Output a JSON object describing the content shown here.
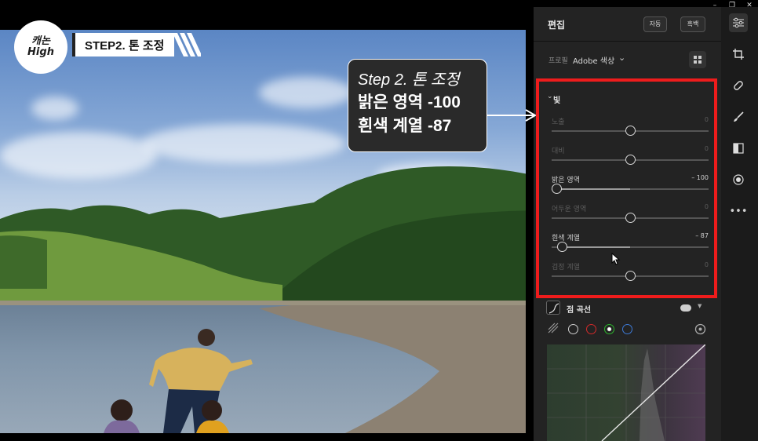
{
  "window": {
    "minimize": "–",
    "restore": "❐",
    "close": "✕"
  },
  "overlay": {
    "logo_line1": "캐논",
    "logo_line2": "High",
    "step_banner": "STEP2. 톤 조정",
    "callout_line1": "Step 2. 톤 조정",
    "callout_line2": "밝은 영역 -100",
    "callout_line3": "흰색 계열 -87"
  },
  "panel": {
    "title": "편집",
    "auto_button": "자동",
    "bw_button": "흑백",
    "profile_label": "프로필",
    "profile_value": "Adobe 색상",
    "light_section": {
      "title": "빛",
      "sliders": [
        {
          "label": "노출",
          "value": "0",
          "level": 0.5,
          "active": false
        },
        {
          "label": "대비",
          "value": "0",
          "level": 0.5,
          "active": false
        },
        {
          "label": "밝은 영역",
          "value": "– 100",
          "level": 0.0,
          "active": true
        },
        {
          "label": "어두운 영역",
          "value": "0",
          "level": 0.5,
          "active": false
        },
        {
          "label": "흰색 계열",
          "value": "– 87",
          "level": 0.065,
          "active": true
        },
        {
          "label": "검정 계열",
          "value": "0",
          "level": 0.5,
          "active": false
        }
      ]
    },
    "curve_section": {
      "title": "점 곡선"
    }
  },
  "tools": [
    "sliders-icon",
    "crop-icon",
    "healing-icon",
    "brush-icon",
    "gradient-icon",
    "radial-icon",
    "more-icon"
  ],
  "colors": {
    "highlight_box": "#ee1c1c",
    "panel_bg": "#232323"
  }
}
